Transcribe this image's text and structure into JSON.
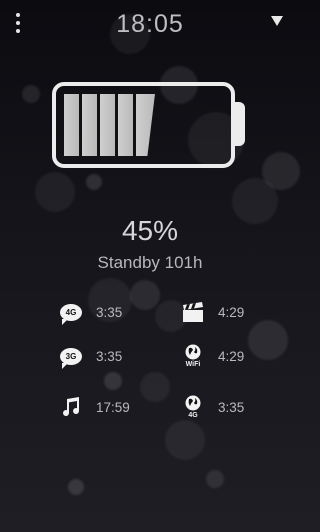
{
  "status": {
    "time": "18:05"
  },
  "battery": {
    "level_percent": 45,
    "percent_text": "45%",
    "standby_text": "Standby 101h"
  },
  "usage_left": [
    {
      "icon": "chat-4g-icon",
      "badge": "4G",
      "value": "3:35"
    },
    {
      "icon": "chat-3g-icon",
      "badge": "3G",
      "value": "3:35"
    },
    {
      "icon": "music-note-icon",
      "value": "17:59"
    }
  ],
  "usage_right": [
    {
      "icon": "clapperboard-icon",
      "value": "4:29"
    },
    {
      "icon": "globe-wifi-icon",
      "badge": "WiFi",
      "value": "4:29"
    },
    {
      "icon": "globe-4g-icon",
      "badge": "4G",
      "value": "3:35"
    }
  ],
  "colors": {
    "foreground": "#cfcfd3",
    "icon": "#f2f2f2",
    "battery_outline": "#ececec"
  }
}
